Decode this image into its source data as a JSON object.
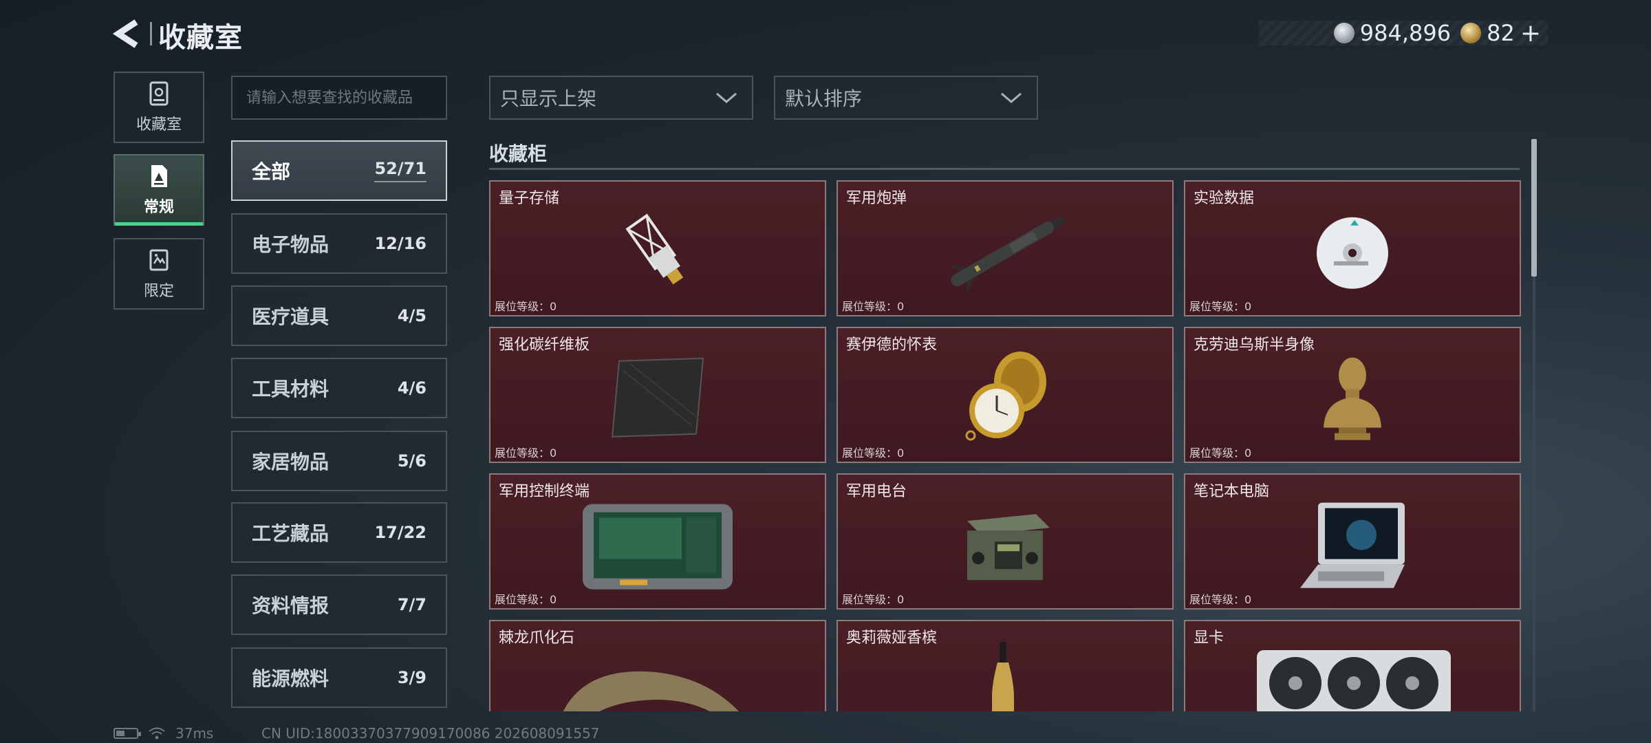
{
  "header": {
    "title": "收藏室",
    "currency_silver": "984,896",
    "currency_gold": "82"
  },
  "nav": [
    {
      "label": "收藏室"
    },
    {
      "label": "常规"
    },
    {
      "label": "限定"
    }
  ],
  "search": {
    "placeholder": "请输入想要查找的收藏品"
  },
  "categories": [
    {
      "name": "全部",
      "count": "52/71"
    },
    {
      "name": "电子物品",
      "count": "12/16"
    },
    {
      "name": "医疗道具",
      "count": "4/5"
    },
    {
      "name": "工具材料",
      "count": "4/6"
    },
    {
      "name": "家居物品",
      "count": "5/6"
    },
    {
      "name": "工艺藏品",
      "count": "17/22"
    },
    {
      "name": "资料情报",
      "count": "7/7"
    },
    {
      "name": "能源燃料",
      "count": "3/9"
    }
  ],
  "filters": {
    "display": "只显示上架",
    "sort": "默认排序"
  },
  "section": {
    "title": "收藏柜"
  },
  "items": [
    {
      "name": "量子存储",
      "level": "展位等级：0",
      "icon": "usb-drive-icon"
    },
    {
      "name": "军用炮弹",
      "level": "展位等级：0",
      "icon": "missile-icon"
    },
    {
      "name": "实验数据",
      "level": "展位等级：0",
      "icon": "disc-icon"
    },
    {
      "name": "强化碳纤维板",
      "level": "展位等级：0",
      "icon": "carbon-plate-icon"
    },
    {
      "name": "赛伊德的怀表",
      "level": "展位等级：0",
      "icon": "pocket-watch-icon"
    },
    {
      "name": "克劳迪乌斯半身像",
      "level": "展位等级：0",
      "icon": "bust-icon"
    },
    {
      "name": "军用控制终端",
      "level": "展位等级：0",
      "icon": "terminal-icon"
    },
    {
      "name": "军用电台",
      "level": "展位等级：0",
      "icon": "radio-icon"
    },
    {
      "name": "笔记本电脑",
      "level": "展位等级：0",
      "icon": "laptop-icon"
    },
    {
      "name": "棘龙爪化石",
      "level": "",
      "icon": "claw-fossil-icon"
    },
    {
      "name": "奥莉薇娅香槟",
      "level": "",
      "icon": "champagne-icon"
    },
    {
      "name": "显卡",
      "level": "",
      "icon": "gpu-icon"
    }
  ],
  "footer": {
    "ping": "37ms",
    "uid": "CN UID:18003370377909170086 202608091557"
  },
  "colors": {
    "card_bg": "#451c23",
    "card_border": "#8d7a7c",
    "active_nav_accent": "#43d68a",
    "background": "#1c252d"
  }
}
